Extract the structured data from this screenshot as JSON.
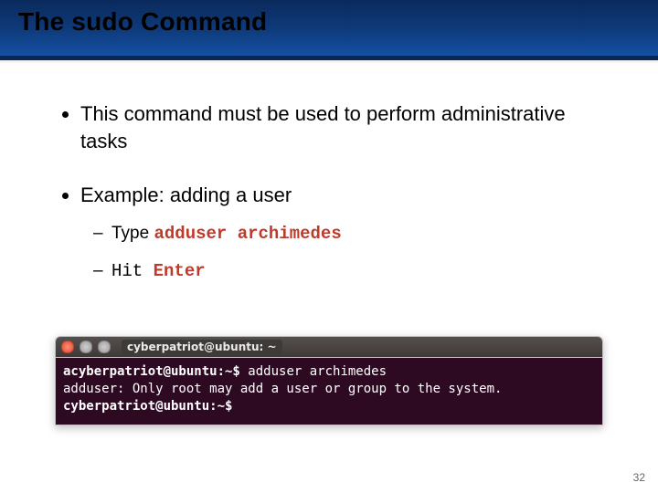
{
  "title": "The sudo Command",
  "bullets": {
    "b1": "This command must be used to perform administrative tasks",
    "b2": "Example: adding a user",
    "sub1_prefix": "Type ",
    "sub1_cmd": "adduser archimedes",
    "sub2_prefix": "Hit ",
    "sub2_key": "Enter"
  },
  "terminal": {
    "window_title": "cyberpatriot@ubuntu: ~",
    "prompt1": "acyberpatriot@ubuntu:~$",
    "cmd1": " adduser archimedes",
    "line2": "adduser: Only root may add a user or group to the system.",
    "prompt3": "cyberpatriot@ubuntu:~$"
  },
  "page_number": "32"
}
